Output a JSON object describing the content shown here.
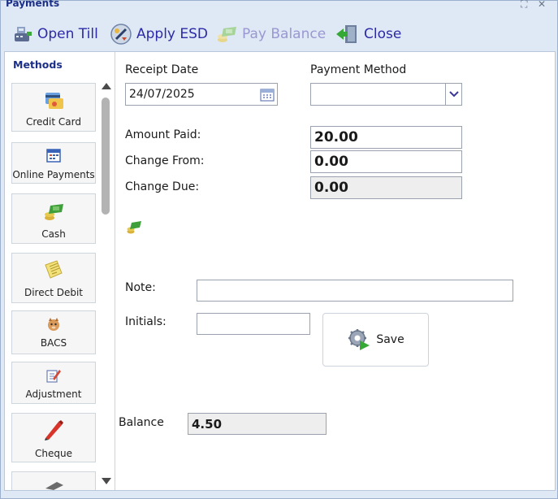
{
  "window": {
    "title": "Payments"
  },
  "toolbar": {
    "open_till": "Open Till",
    "apply_esd": "Apply ESD",
    "pay_balance": "Pay Balance",
    "close": "Close"
  },
  "sidebar": {
    "title": "Methods",
    "items": [
      {
        "label": "Credit Card",
        "icon": "credit-card-icon"
      },
      {
        "label": "Online Payments",
        "icon": "online-payments-icon"
      },
      {
        "label": "Cash",
        "icon": "cash-icon"
      },
      {
        "label": "Direct Debit",
        "icon": "direct-debit-icon"
      },
      {
        "label": "BACS",
        "icon": "bacs-icon"
      },
      {
        "label": "Adjustment",
        "icon": "adjustment-icon"
      },
      {
        "label": "Cheque",
        "icon": "cheque-icon"
      }
    ]
  },
  "form": {
    "receipt_date_label": "Receipt Date",
    "receipt_date_value": "24/07/2025",
    "payment_method_label": "Payment Method",
    "payment_method_value": "",
    "amount_paid_label": "Amount Paid:",
    "amount_paid_value": "20.00",
    "change_from_label": "Change From:",
    "change_from_value": "0.00",
    "change_due_label": "Change Due:",
    "change_due_value": "0.00",
    "note_label": "Note:",
    "note_value": "",
    "initials_label": "Initials:",
    "initials_value": "",
    "save_label": "Save",
    "balance_label": "Balance",
    "balance_value": "4.50"
  },
  "colors": {
    "accent": "#2d2aa6",
    "title": "#1c2f88",
    "window_bg": "#dfe9f6"
  }
}
